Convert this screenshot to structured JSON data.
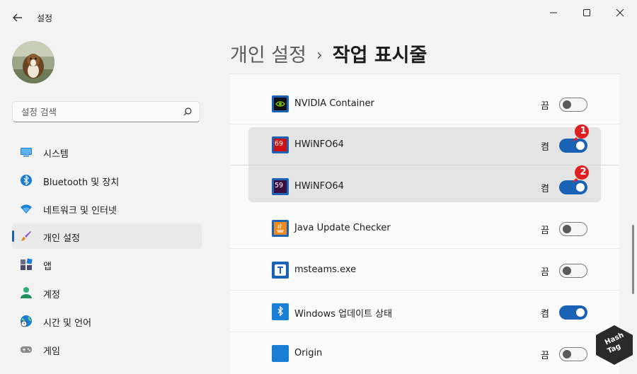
{
  "window": {
    "title": "설정"
  },
  "search": {
    "placeholder": "설정 검색"
  },
  "sidebar": {
    "items": [
      {
        "label": "시스템",
        "icon": "monitor-icon",
        "color": "#1a7fd4"
      },
      {
        "label": "Bluetooth 및 장치",
        "icon": "bluetooth-icon",
        "color": "#1a7fd4"
      },
      {
        "label": "네트워크 및 인터넷",
        "icon": "wifi-icon",
        "color": "#1a7fd4"
      },
      {
        "label": "개인 설정",
        "icon": "brush-icon",
        "color": "#e08a2f",
        "active": true
      },
      {
        "label": "앱",
        "icon": "apps-icon",
        "color": "#4a4a6a"
      },
      {
        "label": "계정",
        "icon": "account-icon",
        "color": "#2fb07a"
      },
      {
        "label": "시간 및 언어",
        "icon": "globe-clock-icon",
        "color": "#1a7fd4"
      },
      {
        "label": "게임",
        "icon": "gamepad-icon",
        "color": "#7a7a7a"
      }
    ]
  },
  "breadcrumb": {
    "parent": "개인 설정",
    "separator": "›",
    "current": "작업 표시줄"
  },
  "apps": [
    {
      "name": "NVIDIA Container",
      "state": "끔",
      "on": false,
      "icon": "nvidia-icon"
    },
    {
      "name": "HWiNFO64",
      "state": "켬",
      "on": true,
      "icon": "hwinfo-icon",
      "icon_text": "69"
    },
    {
      "name": "HWiNFO64",
      "state": "켬",
      "on": true,
      "icon": "hwinfo-icon",
      "icon_text": "59"
    },
    {
      "name": "Java Update Checker",
      "state": "끔",
      "on": false,
      "icon": "java-icon"
    },
    {
      "name": "msteams.exe",
      "state": "끔",
      "on": false,
      "icon": "teams-icon"
    },
    {
      "name": "Windows 업데이트 상태",
      "state": "켬",
      "on": true,
      "icon": "windows-update-icon"
    },
    {
      "name": "Origin",
      "state": "끔",
      "on": false,
      "icon": "origin-icon"
    }
  ],
  "annotations": {
    "badge1": "1",
    "badge2": "2"
  },
  "watermark": {
    "line1": "Hash",
    "line2": "Tag"
  },
  "colors": {
    "accent": "#1a62b4",
    "badge": "#e02020"
  }
}
